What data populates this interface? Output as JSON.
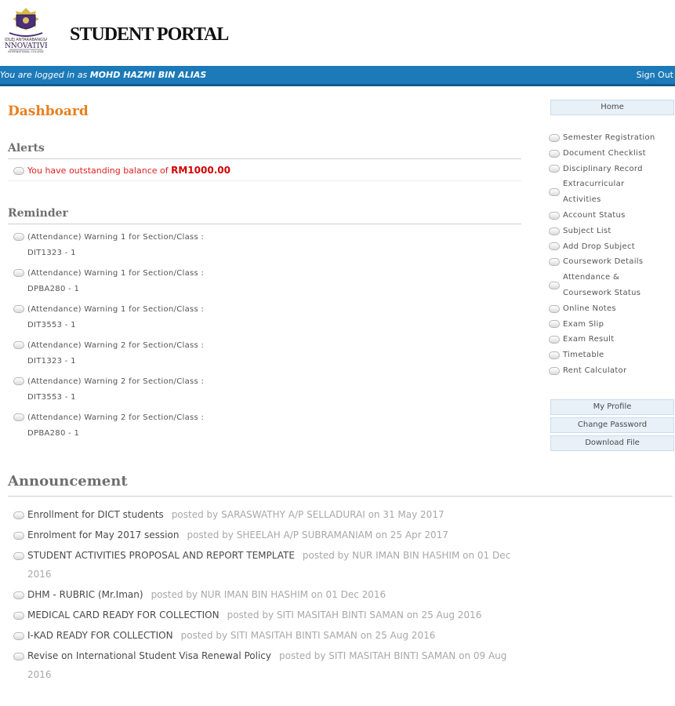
{
  "header": {
    "logo_text": "INNOVATIVE",
    "portal_title": "STUDENT PORTAL"
  },
  "topbar": {
    "logged_prefix": "You are logged in as",
    "user_name": "MOHD HAZMI BIN ALIAS",
    "sign_out": "Sign Out"
  },
  "dashboard": {
    "title": "Dashboard",
    "alerts_heading": "Alerts",
    "alert_text": "You have outstanding balance of",
    "alert_amount": "RM1000.00",
    "reminder_heading": "Reminder",
    "reminders": [
      {
        "text": "(Attendance) Warning 1 for Section/Class :",
        "code": "DIT1323 - 1"
      },
      {
        "text": "(Attendance) Warning 1 for Section/Class :",
        "code": "DPBA280 - 1"
      },
      {
        "text": "(Attendance) Warning 1 for Section/Class :",
        "code": "DIT3553 - 1"
      },
      {
        "text": "(Attendance) Warning 2 for Section/Class :",
        "code": "DIT1323 - 1"
      },
      {
        "text": "(Attendance) Warning 2 for Section/Class :",
        "code": "DIT3553 - 1"
      },
      {
        "text": "(Attendance) Warning 2 for Section/Class :",
        "code": "DPBA280 - 1"
      }
    ]
  },
  "sidebar": {
    "home": "Home",
    "menu": [
      {
        "line1": "Semester Registration",
        "line2": ""
      },
      {
        "line1": "Document Checklist",
        "line2": ""
      },
      {
        "line1": "Disciplinary Record",
        "line2": ""
      },
      {
        "line1": "Extracurricular",
        "line2": "Activities"
      },
      {
        "line1": "Account Status",
        "line2": ""
      },
      {
        "line1": "Subject List",
        "line2": ""
      },
      {
        "line1": "Add Drop Subject",
        "line2": ""
      },
      {
        "line1": "Coursework Details",
        "line2": ""
      },
      {
        "line1": "Attendance &",
        "line2": "Coursework Status"
      },
      {
        "line1": "Online Notes",
        "line2": ""
      },
      {
        "line1": "Exam Slip",
        "line2": ""
      },
      {
        "line1": "Exam Result",
        "line2": ""
      },
      {
        "line1": "Timetable",
        "line2": ""
      },
      {
        "line1": "Rent Calculator",
        "line2": ""
      }
    ],
    "my_profile": "My Profile",
    "change_password": "Change Password",
    "download_file": "Download File"
  },
  "announcement": {
    "heading": "Announcement",
    "items": [
      {
        "title": "Enrollment for DICT students",
        "meta": "posted by SARASWATHY A/P SELLADURAI on 31 May 2017",
        "cont": ""
      },
      {
        "title": "Enrolment for May 2017 session",
        "meta": "posted by SHEELAH A/P SUBRAMANIAM on 25 Apr 2017",
        "cont": ""
      },
      {
        "title": "STUDENT ACTIVITIES PROPOSAL AND REPORT TEMPLATE",
        "meta": "posted by NUR IMAN BIN HASHIM on 01 Dec",
        "cont": "2016"
      },
      {
        "title": "DHM - RUBRIC (Mr.Iman)",
        "meta": "posted by NUR IMAN BIN HASHIM on 01 Dec 2016",
        "cont": ""
      },
      {
        "title": "MEDICAL CARD READY FOR COLLECTION",
        "meta": "posted by SITI MASITAH BINTI SAMAN on 25 Aug 2016",
        "cont": ""
      },
      {
        "title": "I-KAD READY FOR COLLECTION",
        "meta": "posted by SITI MASITAH BINTI SAMAN on 25 Aug 2016",
        "cont": ""
      },
      {
        "title": "Revise on International Student Visa Renewal Policy",
        "meta": "posted by SITI MASITAH BINTI SAMAN on 09 Aug",
        "cont": "2016"
      }
    ]
  },
  "colors": {
    "topbar": "#1c7ab8",
    "accent": "#e87e1d",
    "alert": "#e02020"
  }
}
